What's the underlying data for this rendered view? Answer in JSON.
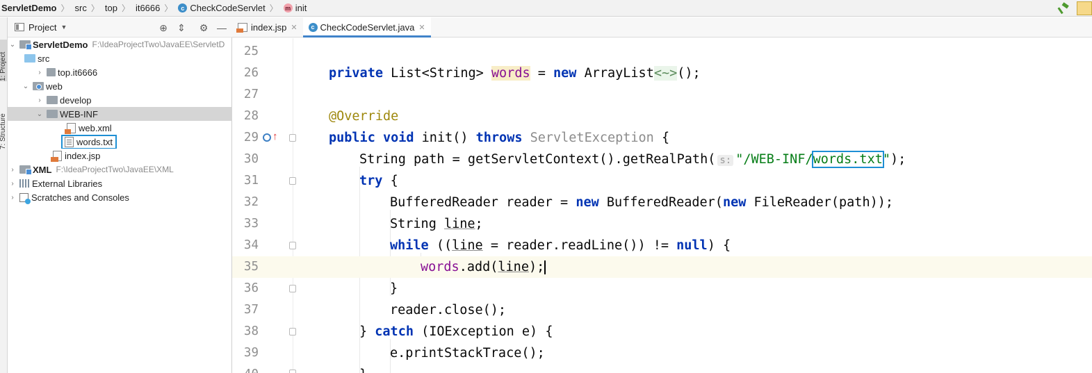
{
  "breadcrumb": {
    "project": "ServletDemo",
    "items": [
      "src",
      "top",
      "it6666",
      "CheckCodeServlet",
      "init"
    ],
    "class_icon_letter": "c",
    "method_icon_letter": "m"
  },
  "side_stripe": {
    "project_tab": "1: Project",
    "structure_tab": "7: Structure"
  },
  "project_panel": {
    "title": "Project",
    "toolbar_icons": [
      "locate-icon",
      "collapse-all-icon",
      "settings-icon",
      "hide-icon"
    ],
    "tree": {
      "root": {
        "label": "ServletDemo",
        "path": "F:\\IdeaProjectTwo\\JavaEE\\ServletD"
      },
      "src": "src",
      "top_pkg": "top.it6666",
      "web": "web",
      "develop": "develop",
      "web_inf": "WEB-INF",
      "web_xml": "web.xml",
      "words_txt": "words.txt",
      "index_jsp": "index.jsp",
      "xml_module": {
        "label": "XML",
        "path": "F:\\IdeaProjectTwo\\JavaEE\\XML"
      },
      "external_libraries": "External Libraries",
      "scratches": "Scratches and Consoles"
    }
  },
  "tabs": [
    {
      "label": "index.jsp",
      "active": false
    },
    {
      "label": "CheckCodeServlet.java",
      "active": true
    }
  ],
  "editor": {
    "line_numbers": [
      "25",
      "26",
      "27",
      "28",
      "29",
      "30",
      "31",
      "32",
      "33",
      "34",
      "35",
      "36",
      "37",
      "38",
      "39",
      "40"
    ],
    "current_line": "35",
    "code": {
      "l26": {
        "private": "private",
        "type": "List<String>",
        "field": "words",
        "eq": "=",
        "new": "new",
        "cls": "ArrayList",
        "diamond": "<~>",
        "end": "();"
      },
      "l28": "@Override",
      "l29": {
        "public": "public",
        "void": "void",
        "name": "init()",
        "throws": "throws",
        "exc": "ServletException",
        "brace": "{"
      },
      "l30": {
        "pre": "String path = getServletContext().getRealPath(",
        "hint": "s:",
        "str_a": "\"/WEB-INF/",
        "str_b": "words.txt",
        "str_c": "\"",
        "end": ");"
      },
      "l31": {
        "try": "try",
        "brace": "{"
      },
      "l32": {
        "a": "BufferedReader reader = ",
        "new1": "new",
        "b": " BufferedReader(",
        "new2": "new",
        "c": " FileReader(path));"
      },
      "l33": {
        "a": "String ",
        "var": "line",
        "b": ";"
      },
      "l34": {
        "while": "while",
        "a": " ((",
        "var": "line",
        "b": " = reader.readLine()) != ",
        "null": "null",
        "c": ") {"
      },
      "l35": {
        "field": "words",
        "a": ".add(",
        "var": "line",
        "b": ");"
      },
      "l36": "}",
      "l37": "reader.close();",
      "l38": {
        "a": "} ",
        "catch": "catch",
        "b": " (IOException e) {"
      },
      "l39": "e.printStackTrace();",
      "l40": "}"
    },
    "colors": {
      "keyword": "#0033b3",
      "field": "#871094",
      "string": "#067d17",
      "annotation": "#9e880d",
      "current_line_bg": "#fcfaed",
      "highlight_box": "#1e8fd4"
    }
  }
}
